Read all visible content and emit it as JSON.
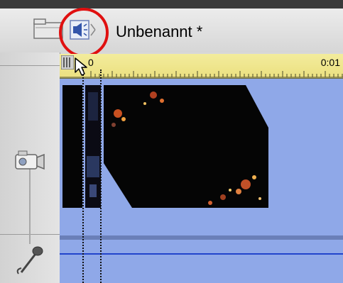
{
  "window": {
    "title": "Unbenannt *"
  },
  "toolbar": {
    "storyboard_icon": "folder-view-icon",
    "timeline_icon": "speaker-timeline-icon"
  },
  "timeline": {
    "ruler": {
      "start_label": "0",
      "end_label": "0:01"
    },
    "tracks": [
      {
        "icon": "camera-icon",
        "type": "video"
      },
      {
        "icon": "microphone-icon",
        "type": "audio"
      }
    ],
    "clips": [
      "clip-1",
      "clip-2",
      "clip-3"
    ]
  },
  "colors": {
    "track_bg": "#8fa8e8",
    "ruler_bg": "#ebe080",
    "highlight": "#e01010",
    "audio_line": "#2244cc"
  }
}
